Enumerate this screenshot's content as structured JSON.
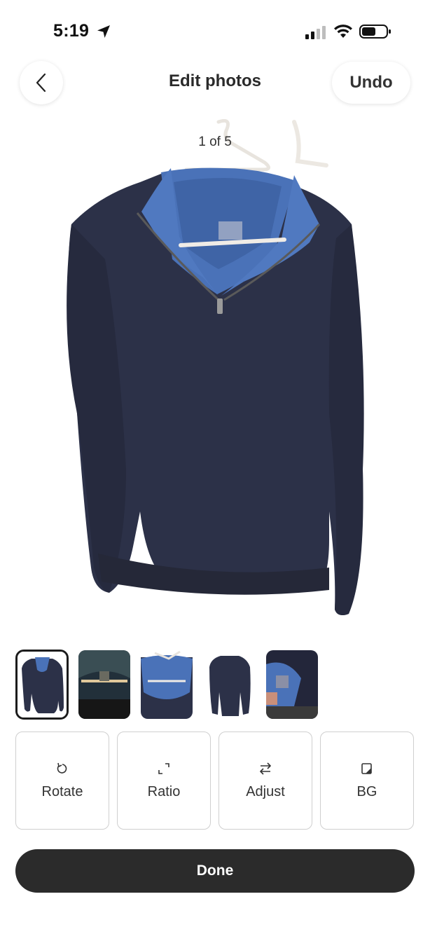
{
  "status_bar": {
    "time": "5:19",
    "location_icon": "location-arrow-icon",
    "signal_icon": "cellular-signal-icon",
    "wifi_icon": "wifi-icon",
    "battery_icon": "battery-icon"
  },
  "header": {
    "back_icon": "chevron-left-icon",
    "title": "Edit photos",
    "undo_label": "Undo"
  },
  "photo": {
    "counter": "1 of 5"
  },
  "thumbnails": [
    {
      "index": 1,
      "selected": true
    },
    {
      "index": 2,
      "selected": false
    },
    {
      "index": 3,
      "selected": false
    },
    {
      "index": 4,
      "selected": false
    },
    {
      "index": 5,
      "selected": false
    }
  ],
  "tools": [
    {
      "label": "Rotate",
      "icon": "rotate-icon"
    },
    {
      "label": "Ratio",
      "icon": "ratio-icon"
    },
    {
      "label": "Adjust",
      "icon": "adjust-icon"
    },
    {
      "label": "BG",
      "icon": "background-icon"
    }
  ],
  "footer": {
    "done_label": "Done"
  },
  "colors": {
    "sweater": "#2c3148",
    "collar": "#4a72b8",
    "done_button": "#2b2b2b"
  }
}
